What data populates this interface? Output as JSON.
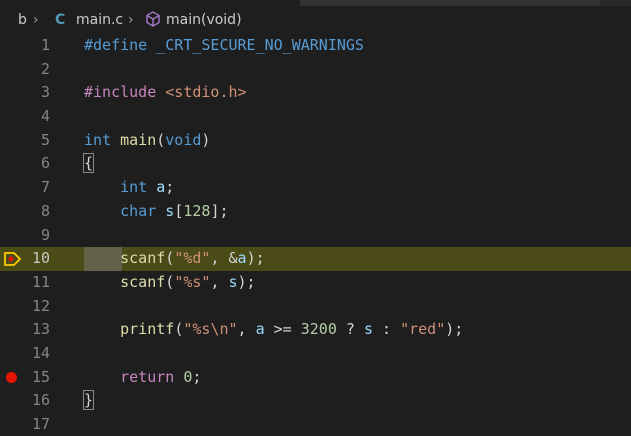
{
  "breadcrumb": {
    "folder": "b",
    "file_icon": "C",
    "file": "main.c",
    "symbol": "main(void)",
    "symbol_icon": "cube-icon"
  },
  "editor": {
    "current_line": 10,
    "breakpoint_line": 15,
    "colors": {
      "background": "#1e1e1e",
      "current_line": "#4b4b18",
      "breakpoint": "#e51400",
      "exec_arrow": "#ffcc00"
    },
    "lines": [
      {
        "n": "1",
        "tokens": [
          [
            "macro",
            "#define "
          ],
          [
            "macro",
            "_CRT_SECURE_NO_WARNINGS"
          ]
        ]
      },
      {
        "n": "2",
        "tokens": []
      },
      {
        "n": "3",
        "tokens": [
          [
            "pp",
            "#include "
          ],
          [
            "inc",
            "<stdio.h>"
          ]
        ]
      },
      {
        "n": "4",
        "tokens": []
      },
      {
        "n": "5",
        "tokens": [
          [
            "kw",
            "int"
          ],
          [
            "",
            " "
          ],
          [
            "fn",
            "main"
          ],
          [
            "",
            "("
          ],
          [
            "kw",
            "void"
          ],
          [
            "",
            ")"
          ]
        ]
      },
      {
        "n": "6",
        "tokens": [
          [
            "",
            "{"
          ]
        ]
      },
      {
        "n": "7",
        "tokens": [
          [
            "",
            "    "
          ],
          [
            "kw",
            "int"
          ],
          [
            "",
            " "
          ],
          [
            "var",
            "a"
          ],
          [
            "",
            ";"
          ]
        ]
      },
      {
        "n": "8",
        "tokens": [
          [
            "",
            "    "
          ],
          [
            "kw",
            "char"
          ],
          [
            "",
            " "
          ],
          [
            "var",
            "s"
          ],
          [
            "",
            "["
          ],
          [
            "num",
            "128"
          ],
          [
            "",
            "];"
          ]
        ]
      },
      {
        "n": "9",
        "tokens": []
      },
      {
        "n": "10",
        "tokens": [
          [
            "",
            "    "
          ],
          [
            "fn",
            "scanf"
          ],
          [
            "",
            "("
          ],
          [
            "str",
            "\"%d\""
          ],
          [
            "",
            ", &"
          ],
          [
            "var",
            "a"
          ],
          [
            "",
            ");"
          ]
        ]
      },
      {
        "n": "11",
        "tokens": [
          [
            "",
            "    "
          ],
          [
            "fn",
            "scanf"
          ],
          [
            "",
            "("
          ],
          [
            "str",
            "\"%s\""
          ],
          [
            "",
            ", "
          ],
          [
            "var",
            "s"
          ],
          [
            "",
            ");"
          ]
        ]
      },
      {
        "n": "12",
        "tokens": []
      },
      {
        "n": "13",
        "tokens": [
          [
            "",
            "    "
          ],
          [
            "fn",
            "printf"
          ],
          [
            "",
            "("
          ],
          [
            "str",
            "\"%s\\n\""
          ],
          [
            "",
            ", "
          ],
          [
            "var",
            "a"
          ],
          [
            "",
            " >= "
          ],
          [
            "num",
            "3200"
          ],
          [
            "",
            " ? "
          ],
          [
            "var",
            "s"
          ],
          [
            "",
            " : "
          ],
          [
            "str",
            "\"red\""
          ],
          [
            "",
            ");"
          ]
        ]
      },
      {
        "n": "14",
        "tokens": []
      },
      {
        "n": "15",
        "tokens": [
          [
            "",
            "    "
          ],
          [
            "pp",
            "return"
          ],
          [
            "",
            " "
          ],
          [
            "num",
            "0"
          ],
          [
            "",
            ";"
          ]
        ]
      },
      {
        "n": "16",
        "tokens": [
          [
            "",
            "}"
          ]
        ]
      },
      {
        "n": "17",
        "tokens": []
      }
    ]
  }
}
